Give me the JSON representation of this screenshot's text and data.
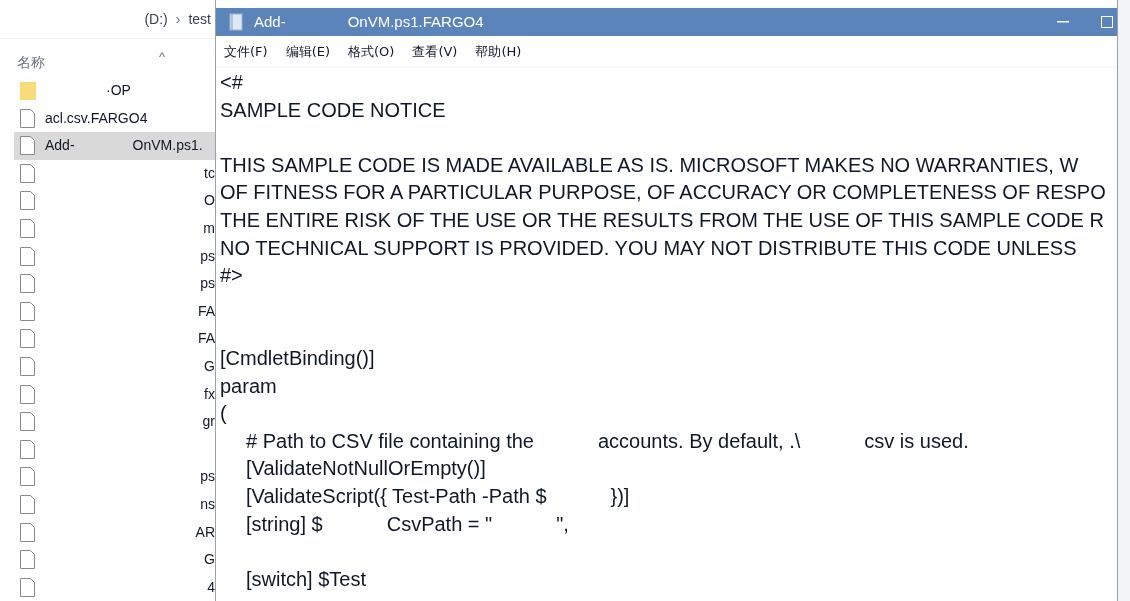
{
  "explorer": {
    "breadcrumb": [
      "(D:)",
      "›",
      "test"
    ],
    "column_header": "名称",
    "sort_caret": "^",
    "files": [
      {
        "kind": "folder",
        "name": [
          "·OP"
        ],
        "selected": false
      },
      {
        "kind": "file",
        "name": [
          "acl.csv.FARGO4"
        ],
        "selected": false
      },
      {
        "kind": "file",
        "name": [
          "Add-",
          "OnVM.ps1."
        ],
        "selected": true
      },
      {
        "kind": "file",
        "name": [
          "tc"
        ],
        "selected": false
      },
      {
        "kind": "file",
        "name": [
          "O"
        ],
        "selected": false
      },
      {
        "kind": "file",
        "name": [
          "m"
        ],
        "selected": false
      },
      {
        "kind": "file",
        "name": [
          "ps"
        ],
        "selected": false
      },
      {
        "kind": "file",
        "name": [
          "ps"
        ],
        "selected": false
      },
      {
        "kind": "file",
        "name": [
          "FA"
        ],
        "selected": false
      },
      {
        "kind": "file",
        "name": [
          "FA"
        ],
        "selected": false
      },
      {
        "kind": "file",
        "name": [
          "G"
        ],
        "selected": false
      },
      {
        "kind": "file",
        "name": [
          "fx"
        ],
        "selected": false
      },
      {
        "kind": "file",
        "name": [
          "gr"
        ],
        "selected": false
      },
      {
        "kind": "file",
        "selected": false
      },
      {
        "kind": "file",
        "name": [
          "ps"
        ],
        "selected": false
      },
      {
        "kind": "file",
        "name": [
          "ns"
        ],
        "selected": false
      },
      {
        "kind": "file",
        "name": [
          "AR"
        ],
        "selected": false
      },
      {
        "kind": "file",
        "name": [
          "G"
        ],
        "selected": false
      },
      {
        "kind": "file",
        "name": [
          "4"
        ],
        "selected": false
      }
    ]
  },
  "notepad": {
    "title": [
      "Add-",
      "OnVM.ps1.FARGO4"
    ],
    "menu": [
      "文件(F)",
      "编辑(E)",
      "格式(O)",
      "查看(V)",
      "帮助(H)"
    ],
    "lines": [
      {
        "kind": "text",
        "segments": [
          "<#"
        ]
      },
      {
        "kind": "text",
        "segments": [
          "SAMPLE CODE NOTICE"
        ]
      },
      {
        "kind": "blank"
      },
      {
        "kind": "text",
        "segments": [
          "THIS SAMPLE CODE IS MADE AVAILABLE AS IS. MICROSOFT MAKES NO WARRANTIES, W"
        ]
      },
      {
        "kind": "text",
        "segments": [
          "OF FITNESS FOR A PARTICULAR PURPOSE, OF ACCURACY OR COMPLETENESS OF RESPO"
        ]
      },
      {
        "kind": "text",
        "segments": [
          "THE ENTIRE RISK OF THE USE OR THE RESULTS FROM THE USE OF THIS SAMPLE CODE R"
        ]
      },
      {
        "kind": "text",
        "segments": [
          "NO TECHNICAL SUPPORT IS PROVIDED. YOU MAY NOT DISTRIBUTE THIS CODE UNLESS"
        ]
      },
      {
        "kind": "text",
        "segments": [
          "#>"
        ]
      },
      {
        "kind": "blank"
      },
      {
        "kind": "blank"
      },
      {
        "kind": "text",
        "segments": [
          "[CmdletBinding()]"
        ]
      },
      {
        "kind": "text",
        "segments": [
          "param"
        ]
      },
      {
        "kind": "text",
        "segments": [
          "("
        ]
      },
      {
        "kind": "indented",
        "segments": [
          "# Path to CSV file containing the",
          "accounts. By default, .\\",
          "csv is used."
        ]
      },
      {
        "kind": "indented",
        "segments": [
          "[ValidateNotNullOrEmpty()]"
        ]
      },
      {
        "kind": "indented",
        "segments": [
          "[ValidateScript({ Test-Path -Path $",
          "})]"
        ]
      },
      {
        "kind": "indented",
        "segments": [
          "[string] $",
          "CsvPath = \"",
          "\","
        ]
      },
      {
        "kind": "blank"
      },
      {
        "kind": "indented",
        "segments": [
          "[switch] $Test"
        ]
      }
    ]
  }
}
